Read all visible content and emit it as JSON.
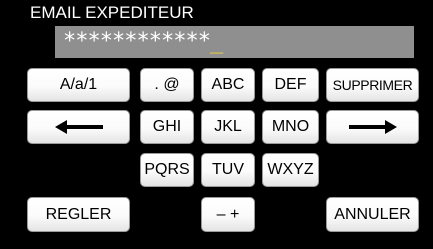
{
  "header": {
    "title": "EMAIL EXPEDITEUR"
  },
  "input": {
    "value": "************",
    "cursor": "_"
  },
  "keyboard": {
    "mode_label": "A/a/1",
    "punctuation_label": ". @",
    "abc_label": "ABC",
    "def_label": "DEF",
    "delete_label": "SUPPRIMER",
    "ghi_label": "GHI",
    "jkl_label": "JKL",
    "mno_label": "MNO",
    "pqrs_label": "PQRS",
    "tuv_label": "TUV",
    "wxyz_label": "WXYZ",
    "set_label": "REGLER",
    "minus_plus_label": "– +",
    "cancel_label": "ANNULER",
    "left_arrow_icon": "arrow-left-icon",
    "right_arrow_icon": "arrow-right-icon"
  },
  "colors": {
    "background": "#000000",
    "field": "#8f8f8f",
    "cursor": "#f1d634",
    "key_face": "#ffffff"
  }
}
